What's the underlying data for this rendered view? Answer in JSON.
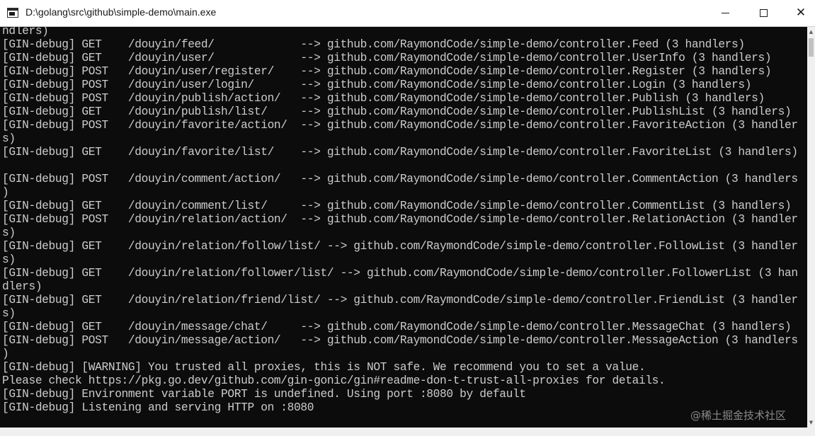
{
  "window": {
    "title": "D:\\golang\\src\\github\\simple-demo\\main.exe",
    "minimize_glyph": "—",
    "maximize_glyph": "□",
    "close_glyph": "✕"
  },
  "console": {
    "background": "#0c0c0c",
    "foreground": "#cccccc",
    "lines": [
      "ndlers)",
      "[GIN-debug] GET    /douyin/feed/             --> github.com/RaymondCode/simple-demo/controller.Feed (3 handlers)",
      "[GIN-debug] GET    /douyin/user/             --> github.com/RaymondCode/simple-demo/controller.UserInfo (3 handlers)",
      "[GIN-debug] POST   /douyin/user/register/    --> github.com/RaymondCode/simple-demo/controller.Register (3 handlers)",
      "[GIN-debug] POST   /douyin/user/login/       --> github.com/RaymondCode/simple-demo/controller.Login (3 handlers)",
      "[GIN-debug] POST   /douyin/publish/action/   --> github.com/RaymondCode/simple-demo/controller.Publish (3 handlers)",
      "[GIN-debug] GET    /douyin/publish/list/     --> github.com/RaymondCode/simple-demo/controller.PublishList (3 handlers)",
      "[GIN-debug] POST   /douyin/favorite/action/  --> github.com/RaymondCode/simple-demo/controller.FavoriteAction (3 handler",
      "s)",
      "[GIN-debug] GET    /douyin/favorite/list/    --> github.com/RaymondCode/simple-demo/controller.FavoriteList (3 handlers)",
      "",
      "[GIN-debug] POST   /douyin/comment/action/   --> github.com/RaymondCode/simple-demo/controller.CommentAction (3 handlers",
      ")",
      "[GIN-debug] GET    /douyin/comment/list/     --> github.com/RaymondCode/simple-demo/controller.CommentList (3 handlers)",
      "[GIN-debug] POST   /douyin/relation/action/  --> github.com/RaymondCode/simple-demo/controller.RelationAction (3 handler",
      "s)",
      "[GIN-debug] GET    /douyin/relation/follow/list/ --> github.com/RaymondCode/simple-demo/controller.FollowList (3 handler",
      "s)",
      "[GIN-debug] GET    /douyin/relation/follower/list/ --> github.com/RaymondCode/simple-demo/controller.FollowerList (3 han",
      "dlers)",
      "[GIN-debug] GET    /douyin/relation/friend/list/ --> github.com/RaymondCode/simple-demo/controller.FriendList (3 handler",
      "s)",
      "[GIN-debug] GET    /douyin/message/chat/     --> github.com/RaymondCode/simple-demo/controller.MessageChat (3 handlers)",
      "[GIN-debug] POST   /douyin/message/action/   --> github.com/RaymondCode/simple-demo/controller.MessageAction (3 handlers",
      ")",
      "[GIN-debug] [WARNING] You trusted all proxies, this is NOT safe. We recommend you to set a value.",
      "Please check https://pkg.go.dev/github.com/gin-gonic/gin#readme-don-t-trust-all-proxies for details.",
      "[GIN-debug] Environment variable PORT is undefined. Using port :8080 by default",
      "[GIN-debug] Listening and serving HTTP on :8080"
    ]
  },
  "scrollbar": {
    "up_glyph": "▲",
    "down_glyph": "▼"
  },
  "watermark": {
    "text": "@稀土掘金技术社区"
  }
}
